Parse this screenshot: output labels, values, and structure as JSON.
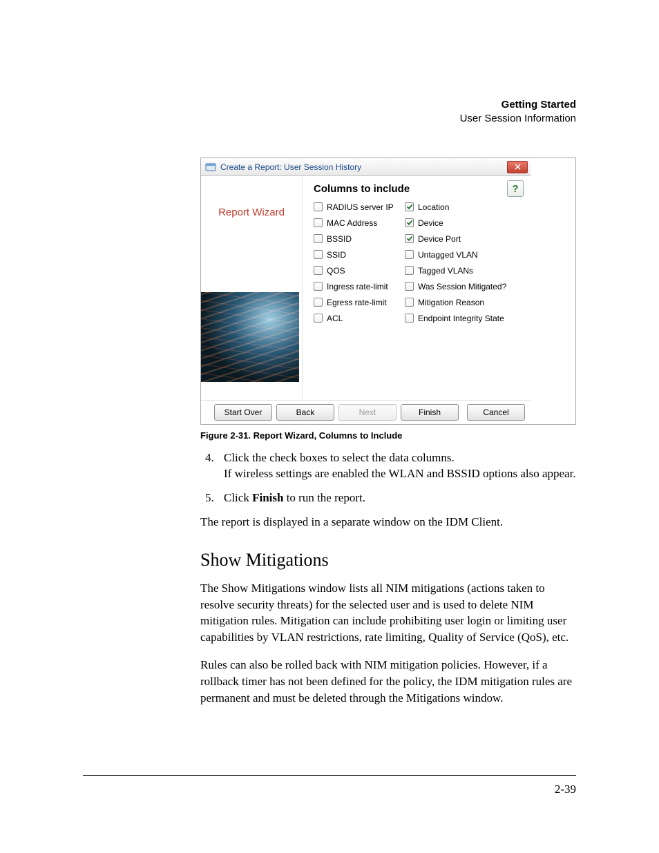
{
  "header": {
    "title": "Getting Started",
    "subtitle": "User Session Information"
  },
  "dialog": {
    "window_title": "Create a Report: User Session History",
    "wizard_label": "Report Wizard",
    "panel_title": "Columns to include",
    "help_glyph": "?",
    "columns_left": [
      {
        "label": "RADIUS server IP",
        "checked": false
      },
      {
        "label": "MAC Address",
        "checked": false
      },
      {
        "label": "BSSID",
        "checked": false
      },
      {
        "label": "SSID",
        "checked": false
      },
      {
        "label": "QOS",
        "checked": false
      },
      {
        "label": "Ingress rate-limit",
        "checked": false
      },
      {
        "label": "Egress rate-limit",
        "checked": false
      },
      {
        "label": "ACL",
        "checked": false
      }
    ],
    "columns_right": [
      {
        "label": "Location",
        "checked": true
      },
      {
        "label": "Device",
        "checked": true
      },
      {
        "label": "Device Port",
        "checked": true
      },
      {
        "label": "Untagged VLAN",
        "checked": false
      },
      {
        "label": "Tagged VLANs",
        "checked": false
      },
      {
        "label": "Was Session Mitigated?",
        "checked": false
      },
      {
        "label": "Mitigation Reason",
        "checked": false
      },
      {
        "label": "Endpoint Integrity State",
        "checked": false
      }
    ],
    "buttons": {
      "start_over": "Start Over",
      "back": "Back",
      "next": "Next",
      "finish": "Finish",
      "cancel": "Cancel"
    }
  },
  "caption": "Figure 2-31. Report Wizard, Columns to Include",
  "steps": {
    "start": 4,
    "items": [
      {
        "line1": "Click the check boxes to select the data columns.",
        "line2": "If wireless settings are enabled the WLAN and BSSID options also appear."
      },
      {
        "line1_prefix": "Click ",
        "line1_bold": "Finish",
        "line1_suffix": " to run the report."
      }
    ]
  },
  "after_steps": "The report is displayed in a separate window on the IDM Client.",
  "section_title": "Show Mitigations",
  "body_paras": [
    "The Show Mitigations window lists all NIM mitigations (actions taken to resolve security threats) for the selected user and is used to delete NIM mitigation rules. Mitigation can include prohibiting user login or limiting user capabilities by VLAN restrictions, rate limiting, Quality of Service (QoS), etc.",
    "Rules can also be rolled back with NIM mitigation policies. However, if a rollback timer has not been defined for the policy, the IDM mitigation rules are permanent and must be deleted through the Mitigations window."
  ],
  "page_number": "2-39"
}
